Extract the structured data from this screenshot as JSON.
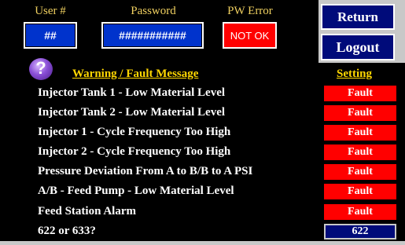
{
  "header": {
    "user_label": "User #",
    "password_label": "Password",
    "pw_error_label": "PW Error"
  },
  "fields": {
    "user_value": "##",
    "password_value": "###########",
    "pw_error_value": "NOT OK"
  },
  "nav": {
    "return_label": "Return",
    "logout_label": "Logout"
  },
  "table": {
    "help_glyph": "?",
    "message_header": "Warning / Fault Message",
    "setting_header": "Setting",
    "rows": [
      {
        "message": "Injector Tank 1 - Low Material Level",
        "setting": "Fault"
      },
      {
        "message": "Injector Tank 2 - Low Material Level",
        "setting": "Fault"
      },
      {
        "message": "Injector 1 - Cycle Frequency Too High",
        "setting": "Fault"
      },
      {
        "message": "Injector 2 - Cycle Frequency Too High",
        "setting": "Fault"
      },
      {
        "message": "Pressure Deviation From A to B/B to A PSI",
        "setting": "Fault"
      },
      {
        "message": "A/B - Feed Pump - Low Material Level",
        "setting": "Fault"
      },
      {
        "message": "Feed Station Alarm",
        "setting": "Fault"
      },
      {
        "message": "622 or 633?",
        "setting": "622"
      }
    ]
  },
  "colors": {
    "background": "#000000",
    "header_text": "#f0d060",
    "field_blue": "#0033cc",
    "fault_red": "#ff0000",
    "nav_blue": "#000b7a",
    "panel_gray": "#c8c8c8"
  }
}
